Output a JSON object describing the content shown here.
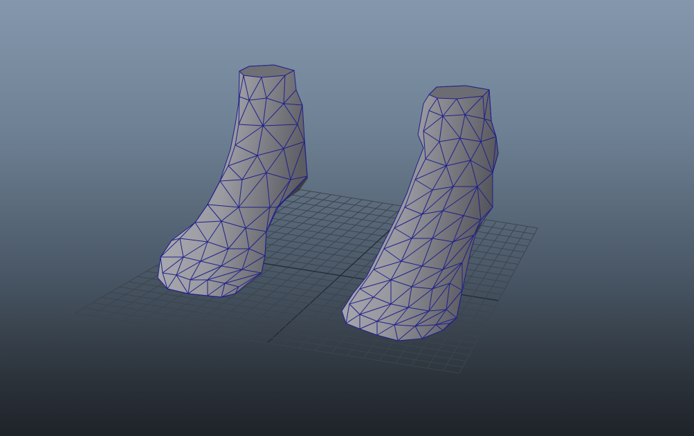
{
  "viewport": {
    "kind": "3d-perspective-view",
    "background_top": "#8497ac",
    "background_bottom": "#1e2329",
    "grid_color": "#3d444c",
    "wireframe_color": "#1f1f8a",
    "surface_color": "#9c9ca3"
  },
  "scene": {
    "objects": [
      {
        "name": "left-foot-mesh",
        "display": "wireframe-on-shaded"
      },
      {
        "name": "right-foot-mesh",
        "display": "wireframe-on-shaded"
      }
    ],
    "grid": {
      "visible": true
    }
  }
}
